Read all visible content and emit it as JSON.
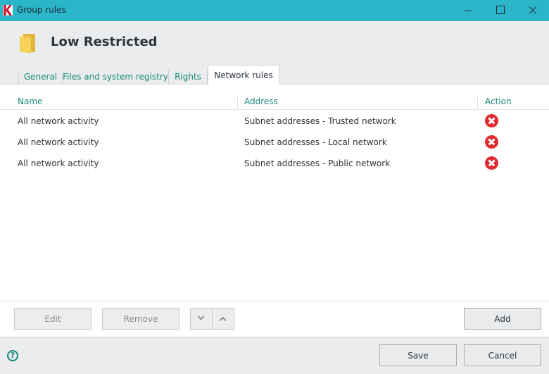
{
  "window": {
    "title": "Group rules",
    "app_icon": "kaspersky-k-icon",
    "controls": [
      "minimize-icon",
      "maximize-icon",
      "close-icon"
    ]
  },
  "header": {
    "group_name": "Low Restricted",
    "icon": "folder-icon"
  },
  "tabs": [
    {
      "label": "General",
      "active": false
    },
    {
      "label": "Files and system registry",
      "active": false
    },
    {
      "label": "Rights",
      "active": false
    },
    {
      "label": "Network rules",
      "active": true
    }
  ],
  "table": {
    "columns": [
      "Name",
      "Address",
      "Action"
    ],
    "rows": [
      {
        "name": "All network activity",
        "address": "Subnet addresses - Trusted network",
        "action_icon": "block-icon"
      },
      {
        "name": "All network activity",
        "address": "Subnet addresses - Local network",
        "action_icon": "block-icon"
      },
      {
        "name": "All network activity",
        "address": "Subnet addresses - Public network",
        "action_icon": "block-icon"
      }
    ]
  },
  "toolbar": {
    "edit_label": "Edit",
    "remove_label": "Remove",
    "move_down_icon": "chevron-down-icon",
    "move_up_icon": "chevron-up-icon",
    "add_label": "Add"
  },
  "footer": {
    "help_icon": "help-icon",
    "help_glyph": "?",
    "save_label": "Save",
    "cancel_label": "Cancel"
  },
  "colors": {
    "titlebar": "#2bb5c8",
    "accent_text": "#1a8a7c",
    "block_icon": "#e12a2f",
    "panel_bg": "#ebeced"
  }
}
